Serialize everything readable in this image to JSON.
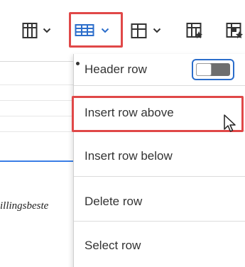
{
  "toolbar": {
    "tools": [
      {
        "name": "table-columns-icon",
        "has_dropdown": true
      },
      {
        "name": "table-rows-icon",
        "has_dropdown": true,
        "active": true
      },
      {
        "name": "table-cell-icon",
        "has_dropdown": true
      },
      {
        "name": "table-properties-icon",
        "has_dropdown": false
      },
      {
        "name": "cell-properties-icon",
        "has_dropdown": false
      }
    ],
    "accent_color": "#2c6ecb",
    "highlight_color": "#e04848"
  },
  "document": {
    "text": "illingsbeste"
  },
  "row_menu": {
    "header_row": {
      "label": "Header row",
      "toggle_state": "off"
    },
    "items": [
      {
        "label": "Insert row above",
        "highlighted": true
      },
      {
        "label": "Insert row below"
      },
      {
        "label": "Delete row"
      },
      {
        "label": "Select row"
      }
    ]
  }
}
